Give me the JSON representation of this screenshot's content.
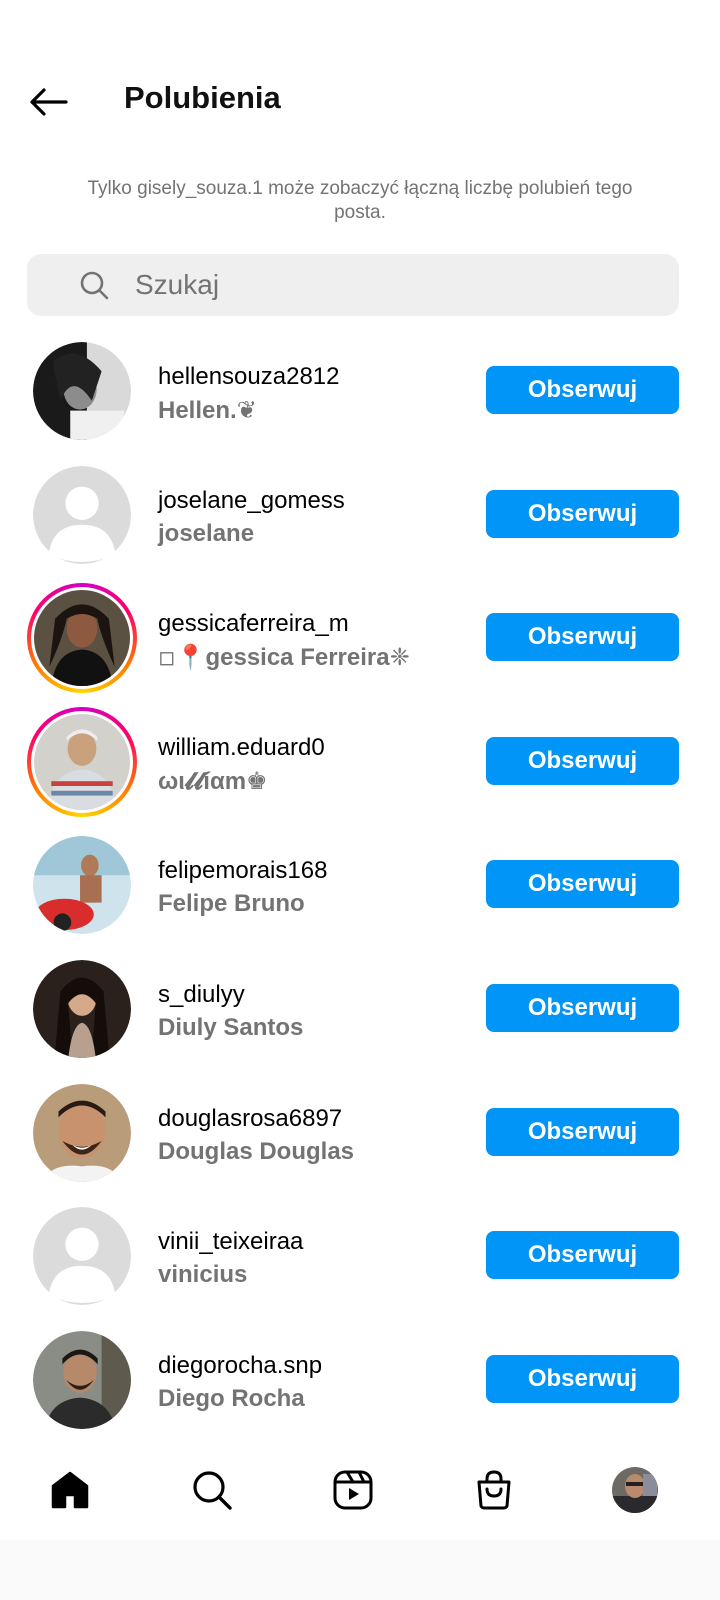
{
  "header": {
    "title": "Polubienia",
    "back_icon": "arrow-left-icon"
  },
  "notice": "Tylko gisely_souza.1 może zobaczyć łączną liczbę polubień tego posta.",
  "search": {
    "placeholder": "Szukaj",
    "value": "",
    "icon": "search-icon"
  },
  "likers": [
    {
      "username": "hellensouza2812",
      "fullname": "Hellen.❦",
      "follow_label": "Obserwuj",
      "story_ring": false,
      "avatar": "photo"
    },
    {
      "username": "joselane_gomess",
      "fullname": "joselane",
      "follow_label": "Obserwuj",
      "story_ring": false,
      "avatar": "default"
    },
    {
      "username": "gessicaferreira_m",
      "fullname": "◽📍gessica Ferreira❈",
      "follow_label": "Obserwuj",
      "story_ring": true,
      "avatar": "photo"
    },
    {
      "username": "william.eduard0",
      "fullname": "ωι𝓵𝓵íαm♚",
      "follow_label": "Obserwuj",
      "story_ring": true,
      "avatar": "photo"
    },
    {
      "username": "felipemorais168",
      "fullname": "Felipe Bruno",
      "follow_label": "Obserwuj",
      "story_ring": false,
      "avatar": "photo"
    },
    {
      "username": "s_diulyy",
      "fullname": "Diuly Santos",
      "follow_label": "Obserwuj",
      "story_ring": false,
      "avatar": "photo"
    },
    {
      "username": "douglasrosa6897",
      "fullname": "Douglas Douglas",
      "follow_label": "Obserwuj",
      "story_ring": false,
      "avatar": "photo"
    },
    {
      "username": "vinii_teixeiraa",
      "fullname": "vinicius",
      "follow_label": "Obserwuj",
      "story_ring": false,
      "avatar": "default"
    },
    {
      "username": "diegorocha.snp",
      "fullname": "Diego Rocha",
      "follow_label": "Obserwuj",
      "story_ring": false,
      "avatar": "photo"
    }
  ],
  "nav": {
    "items": [
      "home-icon",
      "search-icon",
      "reels-icon",
      "shop-icon",
      "profile-avatar"
    ],
    "active": "home-icon"
  },
  "colors": {
    "accent": "#0095f6",
    "secondary_text": "#737373",
    "search_bg": "#efefef"
  }
}
